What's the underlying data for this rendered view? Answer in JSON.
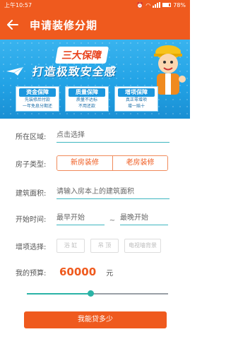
{
  "status_bar": {
    "time": "上午10:57",
    "battery": "78%",
    "battery_level": 0.78
  },
  "app_bar": {
    "title": "申请装修分期",
    "back_icon": "arrow-left-icon"
  },
  "banner": {
    "line1": "三大保障",
    "line2": "打造极致安全感",
    "cards": [
      {
        "title": "资金保障",
        "line1": "先装修后付款",
        "line2": "一年免息分期还"
      },
      {
        "title": "质量保障",
        "line1": "质量不达标",
        "line2": "不用还款"
      },
      {
        "title": "增项保障",
        "line1": "真正零增项",
        "line2": "增一赔十"
      }
    ]
  },
  "form": {
    "area": {
      "label": "所在区域:",
      "placeholder": "点击选择"
    },
    "house_type": {
      "label": "房子类型:",
      "options": [
        "新房装修",
        "老房装修"
      ]
    },
    "building_area": {
      "label": "建筑面积:",
      "placeholder": "请输入房本上的建筑面积"
    },
    "start_time": {
      "label": "开始时间:",
      "earliest": "最早开始",
      "separator": "~",
      "latest": "最晚开始"
    },
    "extras": {
      "label": "增项选择:",
      "options": [
        "浴 缸",
        "吊 顶",
        "电视墙背景"
      ]
    },
    "budget": {
      "label": "我的预算:",
      "amount": "60000",
      "unit": "元",
      "slider_fraction": 0.45
    }
  },
  "submit_label": "我能贷多少",
  "colors": {
    "primary": "#ef5a1e",
    "accent": "#3db6c0",
    "banner": "#22a3e6"
  }
}
